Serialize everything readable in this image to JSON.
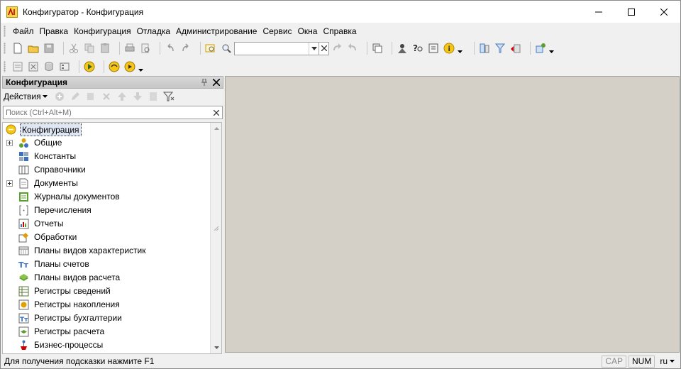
{
  "window": {
    "title": "Конфигуратор - Конфигурация"
  },
  "menu": [
    "Файл",
    "Правка",
    "Конфигурация",
    "Отладка",
    "Администрирование",
    "Сервис",
    "Окна",
    "Справка"
  ],
  "toolbar": {
    "search_value": ""
  },
  "panel": {
    "title": "Конфигурация",
    "actions_label": "Действия",
    "search_placeholder": "Поиск (Ctrl+Alt+M)"
  },
  "tree": {
    "root": "Конфигурация",
    "items": [
      {
        "label": "Общие",
        "icon": "common-icon",
        "expandable": true
      },
      {
        "label": "Константы",
        "icon": "constants-icon",
        "expandable": false
      },
      {
        "label": "Справочники",
        "icon": "catalogs-icon",
        "expandable": false
      },
      {
        "label": "Документы",
        "icon": "documents-icon",
        "expandable": true
      },
      {
        "label": "Журналы документов",
        "icon": "document-journals-icon",
        "expandable": false
      },
      {
        "label": "Перечисления",
        "icon": "enums-icon",
        "expandable": false
      },
      {
        "label": "Отчеты",
        "icon": "reports-icon",
        "expandable": false
      },
      {
        "label": "Обработки",
        "icon": "data-processors-icon",
        "expandable": false
      },
      {
        "label": "Планы видов характеристик",
        "icon": "chart-of-characteristic-types-icon",
        "expandable": false
      },
      {
        "label": "Планы счетов",
        "icon": "chart-of-accounts-icon",
        "expandable": false
      },
      {
        "label": "Планы видов расчета",
        "icon": "chart-of-calculation-types-icon",
        "expandable": false
      },
      {
        "label": "Регистры сведений",
        "icon": "information-registers-icon",
        "expandable": false
      },
      {
        "label": "Регистры накопления",
        "icon": "accumulation-registers-icon",
        "expandable": false
      },
      {
        "label": "Регистры бухгалтерии",
        "icon": "accounting-registers-icon",
        "expandable": false
      },
      {
        "label": "Регистры расчета",
        "icon": "calculation-registers-icon",
        "expandable": false
      },
      {
        "label": "Бизнес-процессы",
        "icon": "business-processes-icon",
        "expandable": false
      }
    ]
  },
  "status": {
    "hint": "Для получения подсказки нажмите F1",
    "cap": "CAP",
    "num": "NUM",
    "lang": "ru"
  },
  "colors": {
    "workspace": "#d4d0c8",
    "selection": "#dfe7f5",
    "icon_yellow": "#e8b800"
  }
}
